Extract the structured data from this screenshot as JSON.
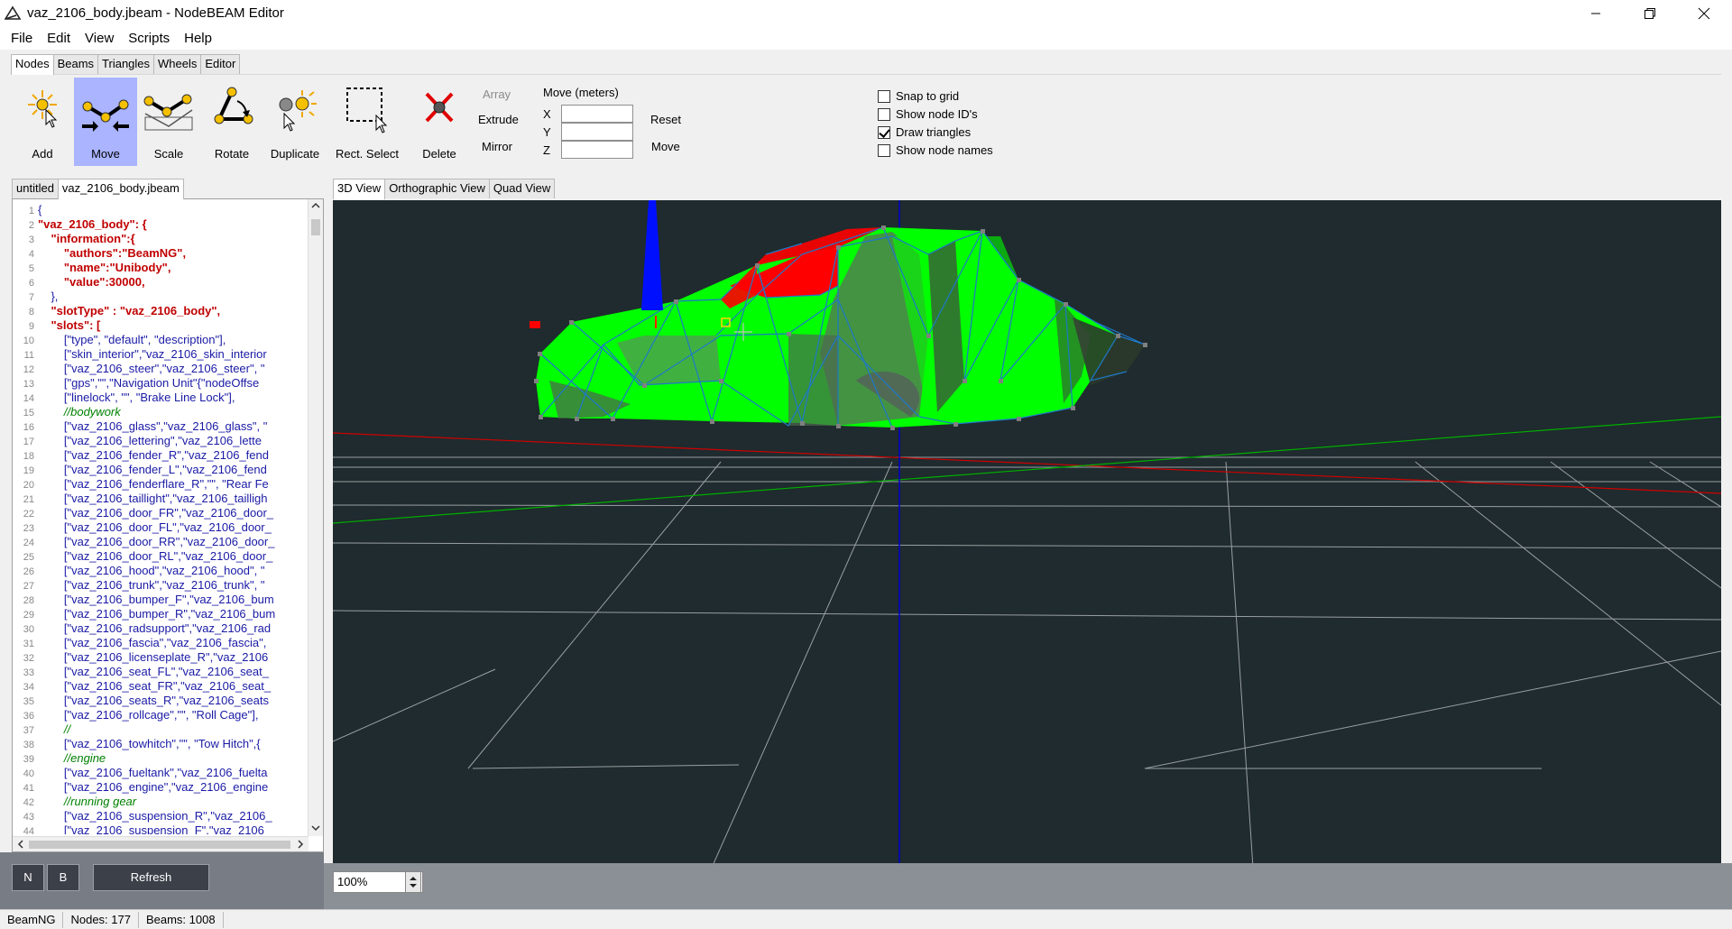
{
  "window": {
    "title": "vaz_2106_body.jbeam - NodeBEAM Editor",
    "controls": [
      "minimize-icon",
      "restore-icon",
      "close-icon"
    ]
  },
  "menu": [
    "File",
    "Edit",
    "View",
    "Scripts",
    "Help"
  ],
  "mode_tabs": [
    "Nodes",
    "Beams",
    "Triangles",
    "Wheels",
    "Editor"
  ],
  "active_mode_tab": "Nodes",
  "tools": [
    {
      "label": "Add",
      "icon": "add-node-icon"
    },
    {
      "label": "Move",
      "icon": "move-node-icon",
      "active": true
    },
    {
      "label": "Scale",
      "icon": "scale-node-icon"
    },
    {
      "label": "Rotate",
      "icon": "rotate-node-icon"
    },
    {
      "label": "Duplicate",
      "icon": "duplicate-node-icon"
    },
    {
      "label": "Rect. Select",
      "icon": "rect-select-icon"
    },
    {
      "label": "Delete",
      "icon": "delete-node-icon"
    }
  ],
  "options": {
    "array": "Array",
    "extrude": "Extrude",
    "mirror": "Mirror",
    "move_heading": "Move (meters)",
    "x_label": "X",
    "y_label": "Y",
    "z_label": "Z",
    "x_value": "",
    "y_value": "",
    "z_value": "",
    "reset": "Reset",
    "move": "Move"
  },
  "checkboxes": [
    {
      "label": "Snap to grid",
      "checked": false
    },
    {
      "label": "Show node ID's",
      "checked": false
    },
    {
      "label": "Draw triangles",
      "checked": true
    },
    {
      "label": "Show node names",
      "checked": false
    }
  ],
  "file_tabs": [
    "untitled",
    "vaz_2106_body.jbeam"
  ],
  "active_file_tab": "vaz_2106_body.jbeam",
  "code_lines": [
    {
      "n": "1",
      "t": "{"
    },
    {
      "n": "2",
      "t": "\"vaz_2106_body\": {"
    },
    {
      "n": "3",
      "t": "    \"information\":{"
    },
    {
      "n": "4",
      "t": "        \"authors\":\"BeamNG\","
    },
    {
      "n": "5",
      "t": "        \"name\":\"Unibody\","
    },
    {
      "n": "6",
      "t": "        \"value\":30000,"
    },
    {
      "n": "7",
      "t": "    },"
    },
    {
      "n": "8",
      "t": "    \"slotType\" : \"vaz_2106_body\","
    },
    {
      "n": "9",
      "t": "    \"slots\": ["
    },
    {
      "n": "10",
      "t": "        [\"type\", \"default\", \"description\"],"
    },
    {
      "n": "11",
      "t": "        [\"skin_interior\",\"vaz_2106_skin_interior"
    },
    {
      "n": "12",
      "t": "        [\"vaz_2106_steer\",\"vaz_2106_steer\", \""
    },
    {
      "n": "13",
      "t": "        [\"gps\",\"\",\"Navigation Unit\"{\"nodeOffse"
    },
    {
      "n": "14",
      "t": "        [\"linelock\", \"\", \"Brake Line Lock\"],"
    },
    {
      "n": "15",
      "t": "        //bodywork"
    },
    {
      "n": "16",
      "t": "        [\"vaz_2106_glass\",\"vaz_2106_glass\", \""
    },
    {
      "n": "17",
      "t": "        [\"vaz_2106_lettering\",\"vaz_2106_lette"
    },
    {
      "n": "18",
      "t": "        [\"vaz_2106_fender_R\",\"vaz_2106_fend"
    },
    {
      "n": "19",
      "t": "        [\"vaz_2106_fender_L\",\"vaz_2106_fend"
    },
    {
      "n": "20",
      "t": "        [\"vaz_2106_fenderflare_R\",\"\", \"Rear Fe"
    },
    {
      "n": "21",
      "t": "        [\"vaz_2106_taillight\",\"vaz_2106_tailligh"
    },
    {
      "n": "22",
      "t": "        [\"vaz_2106_door_FR\",\"vaz_2106_door_"
    },
    {
      "n": "23",
      "t": "        [\"vaz_2106_door_FL\",\"vaz_2106_door_"
    },
    {
      "n": "24",
      "t": "        [\"vaz_2106_door_RR\",\"vaz_2106_door_"
    },
    {
      "n": "25",
      "t": "        [\"vaz_2106_door_RL\",\"vaz_2106_door_"
    },
    {
      "n": "26",
      "t": "        [\"vaz_2106_hood\",\"vaz_2106_hood\", \""
    },
    {
      "n": "27",
      "t": "        [\"vaz_2106_trunk\",\"vaz_2106_trunk\", \""
    },
    {
      "n": "28",
      "t": "        [\"vaz_2106_bumper_F\",\"vaz_2106_bum"
    },
    {
      "n": "29",
      "t": "        [\"vaz_2106_bumper_R\",\"vaz_2106_bum"
    },
    {
      "n": "30",
      "t": "        [\"vaz_2106_radsupport\",\"vaz_2106_rad"
    },
    {
      "n": "31",
      "t": "        [\"vaz_2106_fascia\",\"vaz_2106_fascia\","
    },
    {
      "n": "32",
      "t": "        [\"vaz_2106_licenseplate_R\",\"vaz_2106"
    },
    {
      "n": "33",
      "t": "        [\"vaz_2106_seat_FL\",\"vaz_2106_seat_"
    },
    {
      "n": "34",
      "t": "        [\"vaz_2106_seat_FR\",\"vaz_2106_seat_"
    },
    {
      "n": "35",
      "t": "        [\"vaz_2106_seats_R\",\"vaz_2106_seats"
    },
    {
      "n": "36",
      "t": "        [\"vaz_2106_rollcage\",\"\", \"Roll Cage\"],"
    },
    {
      "n": "37",
      "t": "        //"
    },
    {
      "n": "38",
      "t": "        [\"vaz_2106_towhitch\",\"\", \"Tow Hitch\",{"
    },
    {
      "n": "39",
      "t": "        //engine"
    },
    {
      "n": "40",
      "t": "        [\"vaz_2106_fueltank\",\"vaz_2106_fuelta"
    },
    {
      "n": "41",
      "t": "        [\"vaz_2106_engine\",\"vaz_2106_engine"
    },
    {
      "n": "42",
      "t": "        //running gear"
    },
    {
      "n": "43",
      "t": "        [\"vaz_2106_suspension_R\",\"vaz_2106_"
    },
    {
      "n": "44",
      "t": "        [\"vaz_2106_suspension_F\",\"vaz_2106"
    }
  ],
  "left_buttons": {
    "n": "N",
    "b": "B",
    "refresh": "Refresh"
  },
  "view_tabs": [
    "3D View",
    "Orthographic View",
    "Quad View"
  ],
  "active_view_tab": "3D View",
  "zoom": "100%",
  "status": {
    "app": "BeamNG",
    "nodes": "Nodes: 177",
    "beams": "Beams: 1008"
  },
  "colors": {
    "viewport_bg": "#1f2b2e",
    "body_green": "#00ff00",
    "interior_red": "#ff0000",
    "beam_blue": "#1e78c8",
    "active_tool": "#aab4ff"
  }
}
